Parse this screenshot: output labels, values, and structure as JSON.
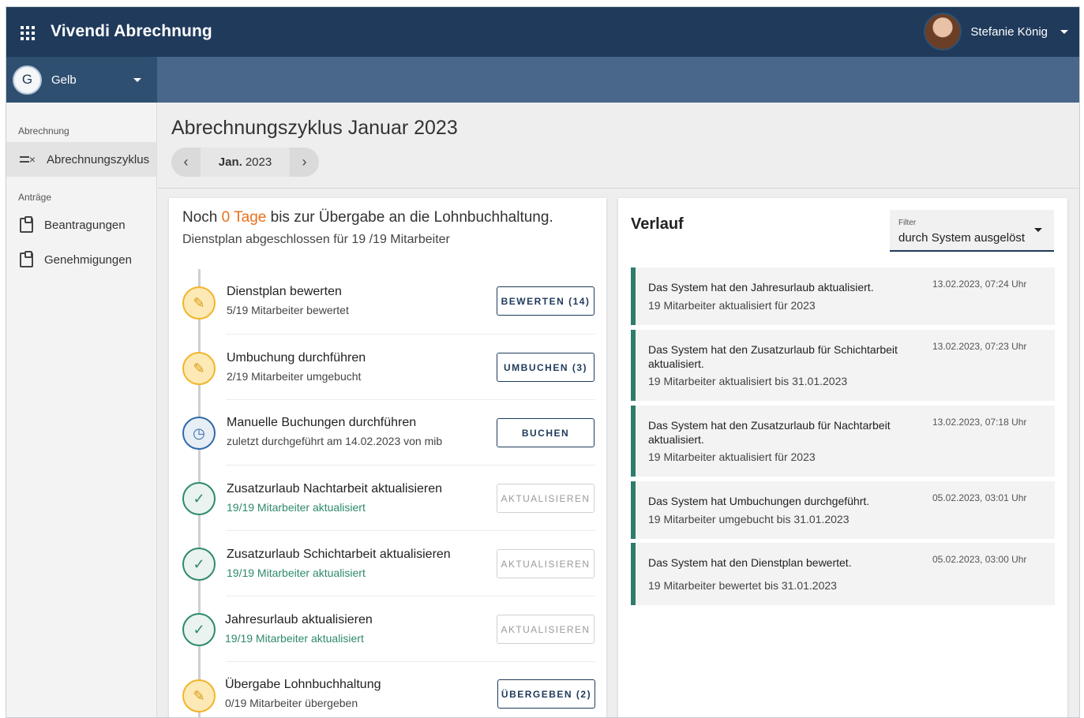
{
  "header": {
    "app_title": "Vivendi Abrechnung",
    "user_name": "Stefanie König"
  },
  "tenant": {
    "badge": "G",
    "name": "Gelb"
  },
  "sidebar": {
    "section1": "Abrechnung",
    "section2": "Anträge",
    "items": [
      {
        "label": "Abrechnungszyklus",
        "icon": "list-check-icon"
      },
      {
        "label": "Beantragungen",
        "icon": "clipboard-icon"
      },
      {
        "label": "Genehmigungen",
        "icon": "clipboard-check-icon"
      }
    ]
  },
  "page": {
    "title": "Abrechnungszyklus Januar 2023",
    "month_bold": "Jan.",
    "year": "2023"
  },
  "status": {
    "prefix": "Noch",
    "days": "0 Tage",
    "suffix": "bis zur Übergabe an die Lohnbuchhaltung.",
    "subline": "Dienstplan abgeschlossen für 19 /19 Mitarbeiter"
  },
  "steps": [
    {
      "title": "Dienstplan bewerten",
      "sub": "5/19 Mitarbeiter bewertet",
      "button": "BEWERTEN (14)",
      "state": "pencil"
    },
    {
      "title": "Umbuchung durchführen",
      "sub": "2/19 Mitarbeiter umgebucht",
      "button": "UMBUCHEN (3)",
      "state": "pencil"
    },
    {
      "title": "Manuelle Buchungen durchführen",
      "sub": "zuletzt durchgeführt am 14.02.2023 von mib",
      "button": "BUCHEN",
      "state": "clock"
    },
    {
      "title": "Zusatzurlaub Nachtarbeit aktualisieren",
      "sub": "19/19 Mitarbeiter aktualisiert",
      "button": "AKTUALISIEREN",
      "state": "check"
    },
    {
      "title": "Zusatzurlaub Schichtarbeit aktualisieren",
      "sub": "19/19 Mitarbeiter aktualisiert",
      "button": "AKTUALISIEREN",
      "state": "check"
    },
    {
      "title": "Jahresurlaub aktualisieren",
      "sub": "19/19 Mitarbeiter aktualisiert",
      "button": "AKTUALISIEREN",
      "state": "check"
    },
    {
      "title": "Übergabe Lohnbuchhaltung",
      "sub": "0/19 Mitarbeiter übergeben",
      "button": "ÜBERGEBEN (2)",
      "state": "pencil"
    }
  ],
  "verlauf": {
    "title": "Verlauf",
    "filter_label": "Filter",
    "filter_value": "durch System ausgelöst",
    "entries": [
      {
        "title": "Das System hat den Jahresurlaub aktualisiert.",
        "sub": "19 Mitarbeiter aktualisiert für 2023",
        "time": "13.02.2023, 07:24 Uhr"
      },
      {
        "title": "Das System hat den Zusatzurlaub für Schichtarbeit aktualisiert.",
        "sub": "19 Mitarbeiter aktualisiert bis 31.01.2023",
        "time": "13.02.2023, 07:23 Uhr"
      },
      {
        "title": "Das System hat den Zusatzurlaub für Nachtarbeit aktualisiert.",
        "sub": "19 Mitarbeiter aktualisiert für 2023",
        "time": "13.02.2023, 07:18 Uhr"
      },
      {
        "title": "Das System hat Umbuchungen durchgeführt.",
        "sub": "19 Mitarbeiter umgebucht bis 31.01.2023",
        "time": "05.02.2023, 03:01 Uhr"
      },
      {
        "title": "Das System hat den Dienstplan bewertet.",
        "sub": "19 Mitarbeiter bewertet bis 31.01.2023",
        "time": "05.02.2023, 03:00 Uhr"
      }
    ]
  },
  "colors": {
    "primary": "#1f3a5b",
    "secondary": "#48678a",
    "accent_orange": "#e8701a",
    "success": "#2e8a6b",
    "warning": "#f1b52a"
  }
}
